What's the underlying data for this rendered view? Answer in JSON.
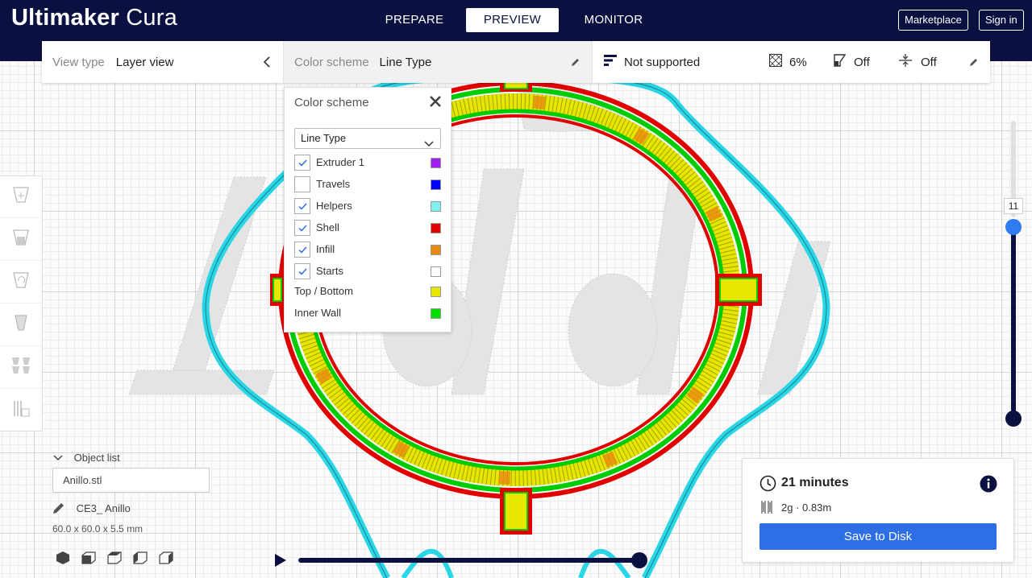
{
  "app": {
    "brand_bold": "Ultimaker",
    "brand_light": "Cura"
  },
  "header": {
    "tabs": [
      {
        "label": "PREPARE",
        "active": false
      },
      {
        "label": "PREVIEW",
        "active": true
      },
      {
        "label": "MONITOR",
        "active": false
      }
    ],
    "marketplace_label": "Marketplace",
    "signin_label": "Sign in"
  },
  "viewbar": {
    "view_type_label": "View type",
    "view_type_value": "Layer view",
    "color_scheme_label": "Color scheme",
    "color_scheme_value": "Line Type",
    "print_setup_profile": "Not supported",
    "infill_value": "6%",
    "support_value": "Off",
    "adhesion_value": "Off"
  },
  "color_scheme_panel": {
    "title": "Color scheme",
    "selected_option": "Line Type",
    "items": [
      {
        "label": "Extruder 1",
        "checkbox": true,
        "checked": true,
        "color": "#a020f0"
      },
      {
        "label": "Travels",
        "checkbox": true,
        "checked": false,
        "color": "#0000ff"
      },
      {
        "label": "Helpers",
        "checkbox": true,
        "checked": true,
        "color": "#7ff0f0"
      },
      {
        "label": "Shell",
        "checkbox": true,
        "checked": true,
        "color": "#e00000"
      },
      {
        "label": "Infill",
        "checkbox": true,
        "checked": true,
        "color": "#e88a10"
      },
      {
        "label": "Starts",
        "checkbox": true,
        "checked": true,
        "color": "#ffffff"
      },
      {
        "label": "Top / Bottom",
        "checkbox": false,
        "checked": false,
        "color": "#e6e600"
      },
      {
        "label": "Inner Wall",
        "checkbox": false,
        "checked": false,
        "color": "#00dd00"
      }
    ]
  },
  "object_list": {
    "toggle_label": "Object list",
    "file_name": "Anillo.stl",
    "object_name": "CE3_ Anillo",
    "dimensions": "60.0 x 60.0 x 5.5 mm"
  },
  "layer_slider": {
    "current_layer": "11"
  },
  "print_info": {
    "time": "21 minutes",
    "material": "2g · 0.83m",
    "save_label": "Save to Disk"
  },
  "colors": {
    "header_bg": "#0a1140",
    "accent_blue": "#2f6fe6",
    "skirt": "#2ad6e6",
    "shell": "#e00000",
    "inner_wall": "#00dd00",
    "top_bottom": "#e6e600",
    "infill": "#e88a10"
  }
}
